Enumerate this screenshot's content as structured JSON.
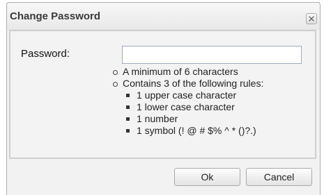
{
  "dialog": {
    "title": "Change Password",
    "close_icon": "close-x-icon"
  },
  "form": {
    "password_label": "Password:",
    "password_value": "",
    "password_placeholder": ""
  },
  "rules": {
    "min_length": "A minimum of 6 characters",
    "contains_header": "Contains 3 of the following rules:",
    "items": [
      "1 upper case character",
      "1 lower case character",
      "1 number",
      "1 symbol (! @ # $% ^ * ()?.)"
    ]
  },
  "buttons": {
    "ok_label": "Ok",
    "cancel_label": "Cancel"
  }
}
